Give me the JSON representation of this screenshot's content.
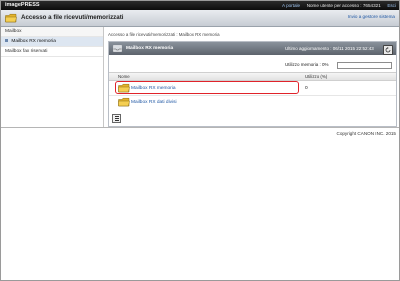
{
  "header": {
    "brand": "imagePRESS",
    "portal_link": "A portale",
    "user_label": "Nome utente per accesso : 7654321",
    "exit_link": "Esci"
  },
  "titlebar": {
    "title": "Accesso a file ricevuti/memorizzati",
    "system_link": "Invio a gestore sistema"
  },
  "sidebar": {
    "items": [
      {
        "label": "Mailbox"
      },
      {
        "label": "Mailbox RX memoria"
      },
      {
        "label": "Mailbox fax riservati"
      }
    ]
  },
  "main": {
    "breadcrumb": "Accesso a file ricevuti/memorizzati : Mailbox RX memoria",
    "panel": {
      "title": "Mailbox RX memoria",
      "last_update": "Ultimo aggiornamento : 06/11 2015 22:52:43",
      "usage_label": "Utilizzo memoria : 0%",
      "usage_fraction": 0.0
    },
    "columns": {
      "name": "Nome",
      "usage": "Utilizzo (%)"
    },
    "rows": [
      {
        "name": "Mailbox RX memoria",
        "usage": "0"
      },
      {
        "name": "Mailbox RX dati divisi",
        "usage": ""
      }
    ]
  },
  "footer": {
    "copyright": "Copyright CANON INC. 2015"
  }
}
